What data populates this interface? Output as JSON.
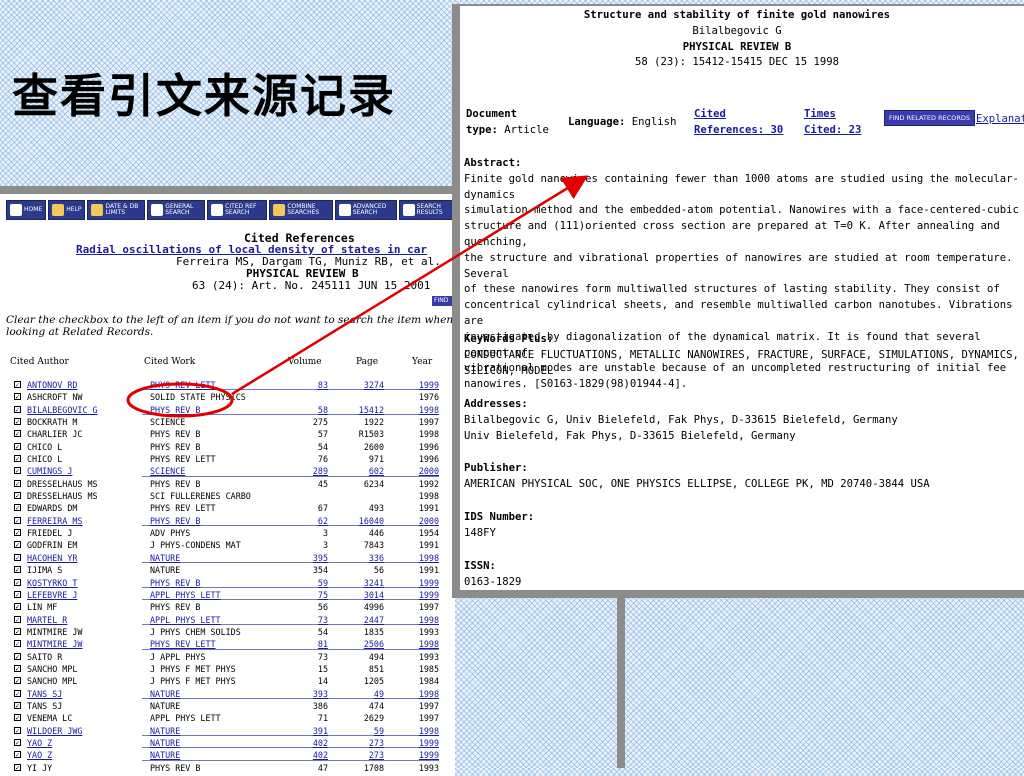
{
  "slide_title": "查看引文来源记录",
  "toolbar": {
    "buttons": [
      {
        "label": "HOME",
        "icon": "home-icon",
        "color": "#ffffff"
      },
      {
        "label": "HELP",
        "icon": "help-icon",
        "color": "#f2c75c"
      },
      {
        "label": "DATE & DB LIMITS",
        "icon": "database-icon",
        "color": "#f2c75c"
      },
      {
        "label": "GENERAL SEARCH",
        "icon": "magnifier-icon",
        "color": "#ffffff"
      },
      {
        "label": "CITED REF SEARCH",
        "icon": "magnifier-icon",
        "color": "#ffffff"
      },
      {
        "label": "COMBINE SEARCHES",
        "icon": "combine-icon",
        "color": "#f2c75c"
      },
      {
        "label": "ADVANCED SEARCH",
        "icon": "magnifier-icon",
        "color": "#ffffff"
      },
      {
        "label": "SEARCH RESULTS",
        "icon": "document-icon",
        "color": "#ffffff"
      }
    ]
  },
  "cited_refs": {
    "heading": "Cited References",
    "article_title": "Radial oscillations of local density of states in car",
    "authors": "Ferreira MS, Dargam TG, Muniz RB, et al.",
    "journal": "PHYSICAL REVIEW B",
    "reference": "63 (24): Art. No. 245111 JUN 15 2001",
    "find_label": "FIND",
    "instructions": "Clear the checkbox to the left of an item if you do not want to search the item when looking at Related Records.",
    "columns": {
      "author": "Cited Author",
      "work": "Cited Work",
      "volume": "Volume",
      "page": "Page",
      "year": "Year"
    },
    "rows": [
      {
        "author": "ANTONOV RD",
        "work": "PHYS REV LETT",
        "volume": "83",
        "page": "3274",
        "year": "1999",
        "link": true
      },
      {
        "author": "ASHCROFT NW",
        "work": "SOLID STATE PHYSICS",
        "volume": "",
        "page": "",
        "year": "1976",
        "link": false
      },
      {
        "author": "BILALBEGOVIC G",
        "work": "PHYS REV B",
        "volume": "58",
        "page": "15412",
        "year": "1998",
        "link": true
      },
      {
        "author": "BOCKRATH M",
        "work": "SCIENCE",
        "volume": "275",
        "page": "1922",
        "year": "1997",
        "link": false
      },
      {
        "author": "CHARLIER JC",
        "work": "PHYS REV B",
        "volume": "57",
        "page": "R1503",
        "year": "1998",
        "link": false
      },
      {
        "author": "CHICO L",
        "work": "PHYS REV B",
        "volume": "54",
        "page": "2600",
        "year": "1996",
        "link": false
      },
      {
        "author": "CHICO L",
        "work": "PHYS REV LETT",
        "volume": "76",
        "page": "971",
        "year": "1996",
        "link": false
      },
      {
        "author": "CUMINGS J",
        "work": "SCIENCE",
        "volume": "289",
        "page": "602",
        "year": "2000",
        "link": true
      },
      {
        "author": "DRESSELHAUS MS",
        "work": "PHYS REV B",
        "volume": "45",
        "page": "6234",
        "year": "1992",
        "link": false
      },
      {
        "author": "DRESSELHAUS MS",
        "work": "SCI FULLERENES CARBO",
        "volume": "",
        "page": "",
        "year": "1998",
        "link": false
      },
      {
        "author": "EDWARDS DM",
        "work": "PHYS REV LETT",
        "volume": "67",
        "page": "493",
        "year": "1991",
        "link": false
      },
      {
        "author": "FERREIRA MS",
        "work": "PHYS REV B",
        "volume": "62",
        "page": "16040",
        "year": "2000",
        "link": true
      },
      {
        "author": "FRIEDEL J",
        "work": "ADV PHYS",
        "volume": "3",
        "page": "446",
        "year": "1954",
        "link": false
      },
      {
        "author": "GODFRIN EM",
        "work": "J PHYS-CONDENS MAT",
        "volume": "3",
        "page": "7843",
        "year": "1991",
        "link": false
      },
      {
        "author": "HACOHEN YR",
        "work": "NATURE",
        "volume": "395",
        "page": "336",
        "year": "1998",
        "link": true
      },
      {
        "author": "IJIMA S",
        "work": "NATURE",
        "volume": "354",
        "page": "56",
        "year": "1991",
        "link": false
      },
      {
        "author": "KOSTYRKO T",
        "work": "PHYS REV B",
        "volume": "59",
        "page": "3241",
        "year": "1999",
        "link": true
      },
      {
        "author": "LEFEBVRE J",
        "work": "APPL PHYS LETT",
        "volume": "75",
        "page": "3014",
        "year": "1999",
        "link": true
      },
      {
        "author": "LIN MF",
        "work": "PHYS REV B",
        "volume": "56",
        "page": "4996",
        "year": "1997",
        "link": false
      },
      {
        "author": "MARTEL R",
        "work": "APPL PHYS LETT",
        "volume": "73",
        "page": "2447",
        "year": "1998",
        "link": true
      },
      {
        "author": "MINTMIRE JW",
        "work": "J PHYS CHEM SOLIDS",
        "volume": "54",
        "page": "1835",
        "year": "1993",
        "link": false
      },
      {
        "author": "MINTMIRE JW",
        "work": "PHYS REV LETT",
        "volume": "81",
        "page": "2506",
        "year": "1998",
        "link": true
      },
      {
        "author": "SAITO R",
        "work": "J APPL PHYS",
        "volume": "73",
        "page": "494",
        "year": "1993",
        "link": false
      },
      {
        "author": "SANCHO MPL",
        "work": "J PHYS F MET PHYS",
        "volume": "15",
        "page": "851",
        "year": "1985",
        "link": false
      },
      {
        "author": "SANCHO MPL",
        "work": "J PHYS F MET PHYS",
        "volume": "14",
        "page": "1205",
        "year": "1984",
        "link": false
      },
      {
        "author": "TANS SJ",
        "work": "NATURE",
        "volume": "393",
        "page": "49",
        "year": "1998",
        "link": true
      },
      {
        "author": "TANS SJ",
        "work": "NATURE",
        "volume": "386",
        "page": "474",
        "year": "1997",
        "link": false
      },
      {
        "author": "VENEMA LC",
        "work": "APPL PHYS LETT",
        "volume": "71",
        "page": "2629",
        "year": "1997",
        "link": false
      },
      {
        "author": "WILDOER JWG",
        "work": "NATURE",
        "volume": "391",
        "page": "59",
        "year": "1998",
        "link": true
      },
      {
        "author": "YAO Z",
        "work": "NATURE",
        "volume": "402",
        "page": "273",
        "year": "1999",
        "link": true
      },
      {
        "author": "YAO Z",
        "work": "NATURE",
        "volume": "402",
        "page": "273",
        "year": "1999",
        "link": true
      },
      {
        "author": "YI JY",
        "work": "PHYS REV B",
        "volume": "47",
        "page": "1708",
        "year": "1993",
        "link": false
      }
    ]
  },
  "record": {
    "title": "Structure and stability of finite gold nanowires",
    "author": "Bilalbegovic G",
    "journal": "PHYSICAL REVIEW B",
    "citation": "58 (23): 15412-15415 DEC 15 1998",
    "doc_type_label": "Document type:",
    "doc_type_label_1": "Document",
    "doc_type_label_2": "type:",
    "doc_type": "Article",
    "language_label": "Language:",
    "language": "English",
    "cited_refs_link_1": "Cited",
    "cited_refs_link_2": "References: 30",
    "times_cited_link_1": "Times",
    "times_cited_link_2": "Cited: 23",
    "find_related": "FIND RELATED RECORDS",
    "explanation": "Explanati",
    "abstract_label": "Abstract:",
    "abstract": "Finite gold nanowires containing fewer than 1000 atoms are studied using the molecular-dynamics\nsimulation method and the embedded-atom potential. Nanowires with a face-centered-cubic\nstructure and (111)oriented cross section are prepared at T=0 K. After annealing and quenching,\nthe structure and vibrational properties of nanowires are studied at room temperature. Several\nof these nanowires form multiwalled structures of lasting stability. They consist of\nconcentrical cylindrical sheets, and resemble multiwalled carbon nanotubes. Vibrations are\ninvestigated by diagonalization of the dynamical matrix. It is found that several percent of\nvibrational modes are unstable because of an uncompleted restructuring of initial fee\nnanowires. [S0163-1829(98)01944-4].",
    "keywords_label": "KeyWords Plus:",
    "keywords": "CONDUCTANCE FLUCTUATIONS, METALLIC NANOWIRES, FRACTURE, SURFACE, SIMULATIONS, DYNAMICS,\nSILICON, MODEL",
    "addresses_label": "Addresses:",
    "addresses": "Bilalbegovic G, Univ Bielefeld, Fak Phys, D-33615 Bielefeld, Germany\nUniv Bielefeld, Fak Phys, D-33615 Bielefeld, Germany",
    "publisher_label": "Publisher:",
    "publisher": "AMERICAN PHYSICAL SOC, ONE PHYSICS ELLIPSE, COLLEGE PK, MD 20740-3844 USA",
    "ids_label": "IDS Number:",
    "ids": "148FY",
    "issn_label": "ISSN:",
    "issn": "0163-1829"
  },
  "colors": {
    "link": "#1a1aa0",
    "annotation": "#e00000",
    "toolbar": "#2c3a8c",
    "frame": "#8c8c8c"
  }
}
